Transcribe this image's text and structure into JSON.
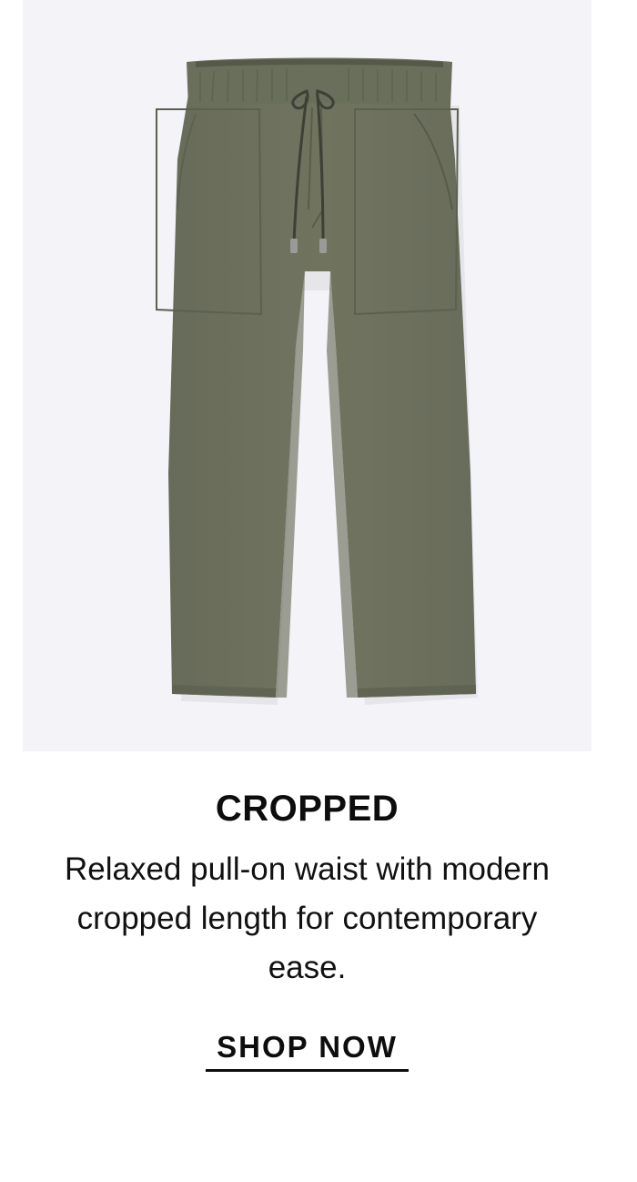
{
  "product": {
    "image_alt": "olive drawstring cropped pants",
    "colors": {
      "panel_background": "#f4f4f8",
      "fabric": "#6f7462",
      "fabric_shadow": "#5c604f",
      "waistband": "#646955",
      "drawcord": "#3e4037",
      "text": "#111111"
    },
    "title": "CROPPED",
    "description": "Relaxed pull-on waist with modern cropped length for contemporary ease.",
    "cta_label": "SHOP NOW"
  }
}
